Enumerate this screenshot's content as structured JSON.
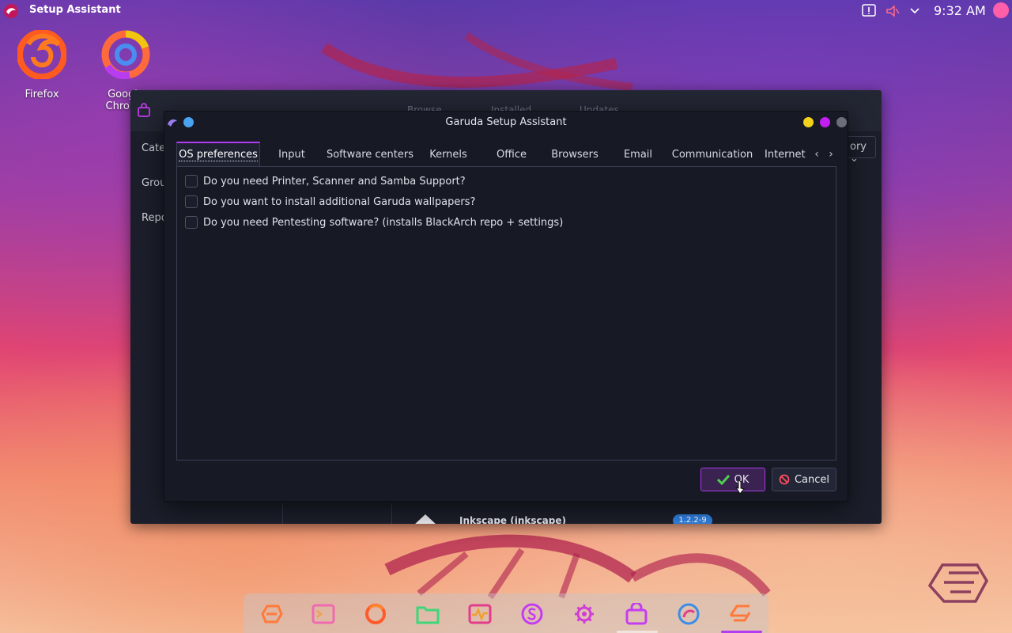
{
  "panel": {
    "app_title": "Setup Assistant",
    "clock": "9:32 AM"
  },
  "desktop": {
    "icons": [
      {
        "label": "Firefox"
      },
      {
        "label": "Google Chrome"
      }
    ]
  },
  "background_app": {
    "sidebar": [
      "Cate",
      "Grou",
      "Repo"
    ],
    "combo_label": "ory",
    "toolbar_hints": [
      "Browse",
      "Installed",
      "Updates"
    ],
    "package_name": "Inkscape (inkscape)",
    "package_version": "1.2.2-9"
  },
  "dialog": {
    "title": "Garuda Setup Assistant",
    "tabs": [
      {
        "label": "OS preferences",
        "active": true
      },
      {
        "label": "Input"
      },
      {
        "label": "Software centers"
      },
      {
        "label": "Kernels"
      },
      {
        "label": "Office"
      },
      {
        "label": "Browsers"
      },
      {
        "label": "Email"
      },
      {
        "label": "Communication"
      },
      {
        "label": "Internet"
      }
    ],
    "options": [
      {
        "label": "Do you need Printer, Scanner and Samba Support?",
        "checked": false
      },
      {
        "label": "Do you want to install additional Garuda wallpapers?",
        "checked": false
      },
      {
        "label": "Do you need Pentesting software? (installs BlackArch repo + settings)",
        "checked": false
      }
    ],
    "ok_label": "OK",
    "cancel_label": "Cancel"
  },
  "colors": {
    "accent": "#a63ae8",
    "dialog_bg": "#171a25",
    "tb_blue": "#4aa3f0",
    "tb_yellow": "#f2d21b",
    "tb_magenta": "#c21ff0",
    "tb_gray": "#6b6f7a"
  },
  "dock": {
    "icons": [
      "garuda-icon",
      "terminal-icon",
      "firefox-icon",
      "files-icon",
      "system-monitor-icon",
      "settings-s-icon",
      "gear-icon",
      "store-bag-icon",
      "browser-icon",
      "garuda-assistant-icon"
    ]
  }
}
